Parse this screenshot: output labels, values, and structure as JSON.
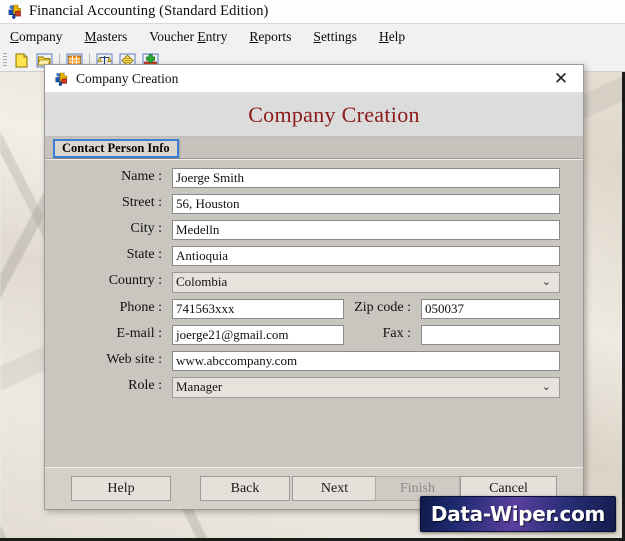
{
  "app": {
    "title": "Financial Accounting (Standard Edition)",
    "icon": "puzzle-pieces-icon"
  },
  "menubar": {
    "items": [
      {
        "label": "Company",
        "accel_index": 0,
        "name": "menu-company"
      },
      {
        "label": "Masters",
        "accel_index": 0,
        "name": "menu-masters"
      },
      {
        "label": "Voucher Entry",
        "accel_index": 8,
        "name": "menu-voucher-entry"
      },
      {
        "label": "Reports",
        "accel_index": 0,
        "name": "menu-reports"
      },
      {
        "label": "Settings",
        "accel_index": 0,
        "name": "menu-settings"
      },
      {
        "label": "Help",
        "accel_index": 0,
        "name": "menu-help"
      }
    ]
  },
  "toolbar": {
    "buttons": [
      {
        "icon": "new-document-icon"
      },
      {
        "icon": "open-folder-icon"
      },
      {
        "icon": "calculator-icon"
      },
      {
        "icon": "balance-scale-icon"
      },
      {
        "icon": "diamond-note-icon"
      },
      {
        "icon": "add-green-plus-icon"
      }
    ]
  },
  "dialog": {
    "window_title": "Company Creation",
    "window_icon": "puzzle-pieces-icon",
    "close_label": "✕",
    "heading": "Company Creation",
    "heading_color": "#8b1a1a",
    "tab": {
      "label": "Contact Person Info",
      "selected": true,
      "accent": "#3a7fd5"
    },
    "fields": [
      {
        "label": "Name :",
        "value": "Joerge Smith",
        "type": "text",
        "name": "name"
      },
      {
        "label": "Street :",
        "value": "56, Houston",
        "type": "text",
        "name": "street"
      },
      {
        "label": "City :",
        "value": "Medelln",
        "type": "text",
        "name": "city"
      },
      {
        "label": "State :",
        "value": "Antioquia",
        "type": "text",
        "name": "state"
      },
      {
        "label": "Country :",
        "value": "Colombia",
        "type": "dropdown",
        "name": "country"
      },
      {
        "label": "Phone :",
        "value": "741563xxx",
        "type": "text",
        "name": "phone"
      },
      {
        "label": "Zip code :",
        "value": "050037",
        "type": "text",
        "name": "zip-code"
      },
      {
        "label": "E-mail :",
        "value": "joerge21@gmail.com",
        "type": "text",
        "name": "email"
      },
      {
        "label": "Fax :",
        "value": "",
        "type": "text",
        "name": "fax"
      },
      {
        "label": "Web site :",
        "value": "www.abccompany.com",
        "type": "text",
        "name": "website"
      },
      {
        "label": "Role :",
        "value": "Manager",
        "type": "dropdown",
        "name": "role"
      }
    ],
    "buttons": [
      {
        "label": "Help",
        "disabled": false,
        "name": "help-button"
      },
      {
        "label": "Back",
        "disabled": false,
        "name": "back-button"
      },
      {
        "label": "Next",
        "disabled": false,
        "name": "next-button"
      },
      {
        "label": "Finish",
        "disabled": true,
        "name": "finish-button"
      },
      {
        "label": "Cancel",
        "disabled": false,
        "name": "cancel-button"
      }
    ]
  },
  "watermark": {
    "text": "Data-Wiper.com"
  }
}
